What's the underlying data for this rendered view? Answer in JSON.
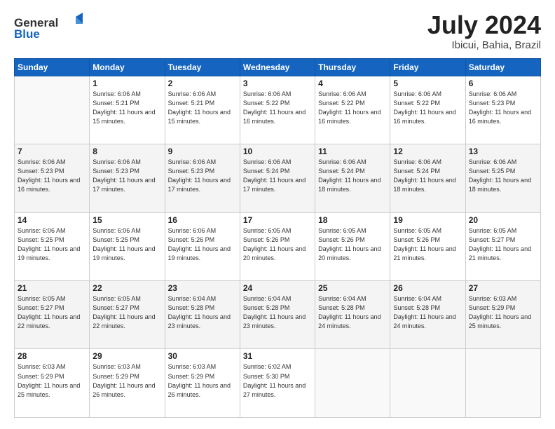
{
  "header": {
    "logo_general": "General",
    "logo_blue": "Blue",
    "month": "July 2024",
    "location": "Ibicui, Bahia, Brazil"
  },
  "days_of_week": [
    "Sunday",
    "Monday",
    "Tuesday",
    "Wednesday",
    "Thursday",
    "Friday",
    "Saturday"
  ],
  "weeks": [
    [
      {
        "day": "",
        "empty": true
      },
      {
        "day": "1",
        "sunrise": "6:06 AM",
        "sunset": "5:21 PM",
        "daylight": "11 hours and 15 minutes."
      },
      {
        "day": "2",
        "sunrise": "6:06 AM",
        "sunset": "5:21 PM",
        "daylight": "11 hours and 15 minutes."
      },
      {
        "day": "3",
        "sunrise": "6:06 AM",
        "sunset": "5:22 PM",
        "daylight": "11 hours and 16 minutes."
      },
      {
        "day": "4",
        "sunrise": "6:06 AM",
        "sunset": "5:22 PM",
        "daylight": "11 hours and 16 minutes."
      },
      {
        "day": "5",
        "sunrise": "6:06 AM",
        "sunset": "5:22 PM",
        "daylight": "11 hours and 16 minutes."
      },
      {
        "day": "6",
        "sunrise": "6:06 AM",
        "sunset": "5:23 PM",
        "daylight": "11 hours and 16 minutes."
      }
    ],
    [
      {
        "day": "7",
        "sunrise": "6:06 AM",
        "sunset": "5:23 PM",
        "daylight": "11 hours and 16 minutes."
      },
      {
        "day": "8",
        "sunrise": "6:06 AM",
        "sunset": "5:23 PM",
        "daylight": "11 hours and 17 minutes."
      },
      {
        "day": "9",
        "sunrise": "6:06 AM",
        "sunset": "5:23 PM",
        "daylight": "11 hours and 17 minutes."
      },
      {
        "day": "10",
        "sunrise": "6:06 AM",
        "sunset": "5:24 PM",
        "daylight": "11 hours and 17 minutes."
      },
      {
        "day": "11",
        "sunrise": "6:06 AM",
        "sunset": "5:24 PM",
        "daylight": "11 hours and 18 minutes."
      },
      {
        "day": "12",
        "sunrise": "6:06 AM",
        "sunset": "5:24 PM",
        "daylight": "11 hours and 18 minutes."
      },
      {
        "day": "13",
        "sunrise": "6:06 AM",
        "sunset": "5:25 PM",
        "daylight": "11 hours and 18 minutes."
      }
    ],
    [
      {
        "day": "14",
        "sunrise": "6:06 AM",
        "sunset": "5:25 PM",
        "daylight": "11 hours and 19 minutes."
      },
      {
        "day": "15",
        "sunrise": "6:06 AM",
        "sunset": "5:25 PM",
        "daylight": "11 hours and 19 minutes."
      },
      {
        "day": "16",
        "sunrise": "6:06 AM",
        "sunset": "5:26 PM",
        "daylight": "11 hours and 19 minutes."
      },
      {
        "day": "17",
        "sunrise": "6:05 AM",
        "sunset": "5:26 PM",
        "daylight": "11 hours and 20 minutes."
      },
      {
        "day": "18",
        "sunrise": "6:05 AM",
        "sunset": "5:26 PM",
        "daylight": "11 hours and 20 minutes."
      },
      {
        "day": "19",
        "sunrise": "6:05 AM",
        "sunset": "5:26 PM",
        "daylight": "11 hours and 21 minutes."
      },
      {
        "day": "20",
        "sunrise": "6:05 AM",
        "sunset": "5:27 PM",
        "daylight": "11 hours and 21 minutes."
      }
    ],
    [
      {
        "day": "21",
        "sunrise": "6:05 AM",
        "sunset": "5:27 PM",
        "daylight": "11 hours and 22 minutes."
      },
      {
        "day": "22",
        "sunrise": "6:05 AM",
        "sunset": "5:27 PM",
        "daylight": "11 hours and 22 minutes."
      },
      {
        "day": "23",
        "sunrise": "6:04 AM",
        "sunset": "5:28 PM",
        "daylight": "11 hours and 23 minutes."
      },
      {
        "day": "24",
        "sunrise": "6:04 AM",
        "sunset": "5:28 PM",
        "daylight": "11 hours and 23 minutes."
      },
      {
        "day": "25",
        "sunrise": "6:04 AM",
        "sunset": "5:28 PM",
        "daylight": "11 hours and 24 minutes."
      },
      {
        "day": "26",
        "sunrise": "6:04 AM",
        "sunset": "5:28 PM",
        "daylight": "11 hours and 24 minutes."
      },
      {
        "day": "27",
        "sunrise": "6:03 AM",
        "sunset": "5:29 PM",
        "daylight": "11 hours and 25 minutes."
      }
    ],
    [
      {
        "day": "28",
        "sunrise": "6:03 AM",
        "sunset": "5:29 PM",
        "daylight": "11 hours and 25 minutes."
      },
      {
        "day": "29",
        "sunrise": "6:03 AM",
        "sunset": "5:29 PM",
        "daylight": "11 hours and 26 minutes."
      },
      {
        "day": "30",
        "sunrise": "6:03 AM",
        "sunset": "5:29 PM",
        "daylight": "11 hours and 26 minutes."
      },
      {
        "day": "31",
        "sunrise": "6:02 AM",
        "sunset": "5:30 PM",
        "daylight": "11 hours and 27 minutes."
      },
      {
        "day": "",
        "empty": true
      },
      {
        "day": "",
        "empty": true
      },
      {
        "day": "",
        "empty": true
      }
    ]
  ]
}
